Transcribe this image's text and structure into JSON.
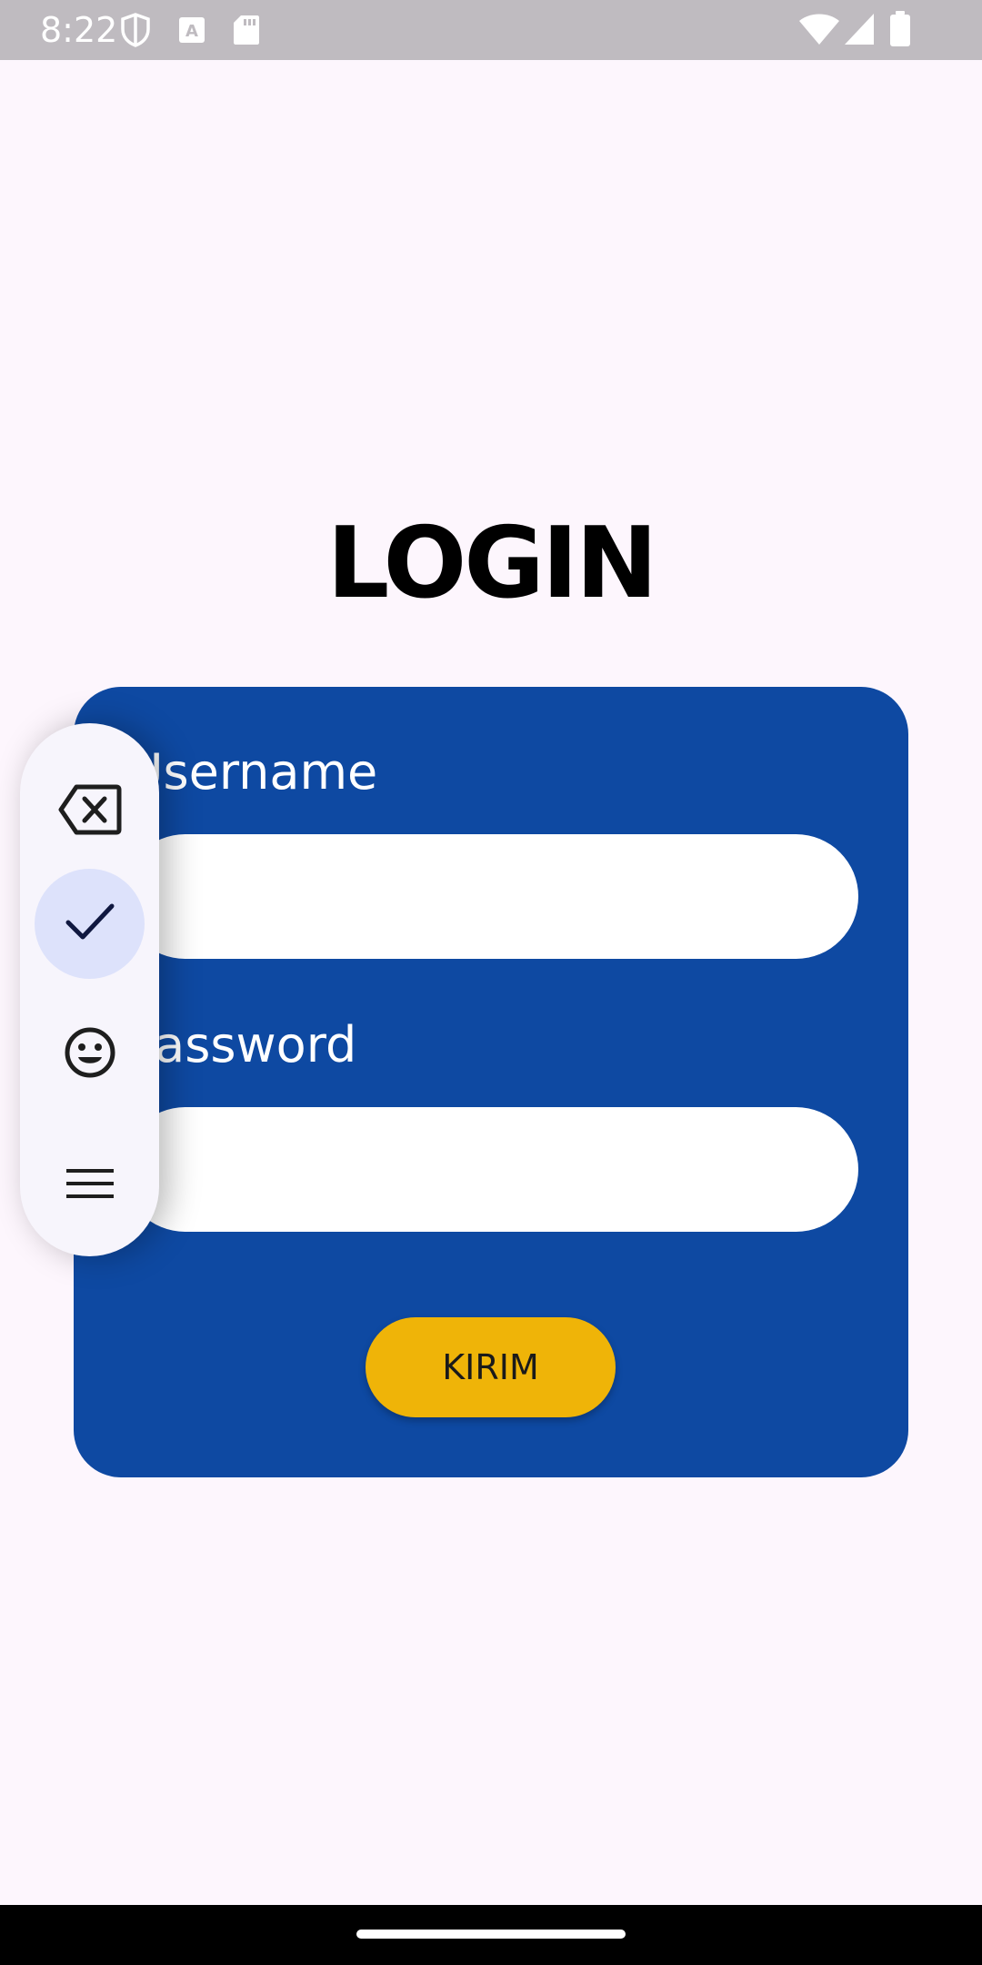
{
  "status_bar": {
    "time": "8:22",
    "left_icons": [
      "shield-icon",
      "keyboard-a-icon",
      "sd-card-icon"
    ],
    "right_icons": [
      "wifi-icon",
      "signal-icon",
      "battery-icon"
    ]
  },
  "page": {
    "title": "LOGIN"
  },
  "form": {
    "username_label": "Username",
    "username_value": "",
    "password_label": "Password",
    "password_value": "",
    "submit_label": "KIRIM"
  },
  "floating_toolbar": {
    "buttons": [
      "backspace-icon",
      "check-icon",
      "emoji-icon",
      "menu-icon"
    ],
    "active": "check-icon"
  },
  "colors": {
    "background": "#fdf6fd",
    "card": "#0e49a2",
    "submit": "#efb408",
    "toolbar": "#f7f5fc",
    "toolbar_active": "#dde2fb"
  }
}
